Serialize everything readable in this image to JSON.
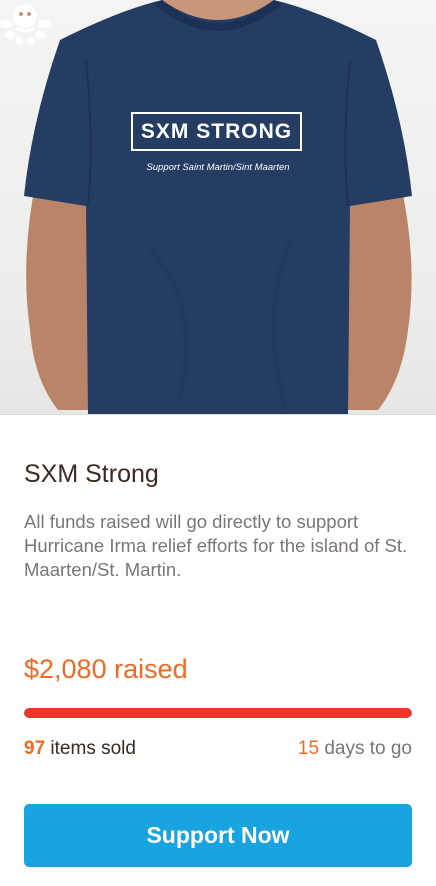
{
  "product": {
    "image_alt": "Navy t-shirt",
    "shirt_logo": "SXM STRONG",
    "shirt_tagline": "Support Saint Martin/Sint Maarten",
    "badge_icon": "sun-octopus-logo-icon"
  },
  "campaign": {
    "title": "SXM Strong",
    "description": "All funds raised will go directly to support Hurricane Irma relief efforts for the island of St. Maarten/St. Martin.",
    "raised_amount": "$2,080",
    "raised_label": " raised",
    "progress_fraction": 1.0,
    "items_sold_count": "97",
    "items_sold_label": " items sold",
    "days_count": "15",
    "days_label": " days to go",
    "cta_label": "Support Now"
  },
  "colors": {
    "accent_orange": "#f06a24",
    "progress_red": "#e8372b",
    "button_blue": "#19a3df",
    "shirt_navy": "#253d63",
    "title_brown": "#3a2a22",
    "body_gray": "#7a7674"
  }
}
